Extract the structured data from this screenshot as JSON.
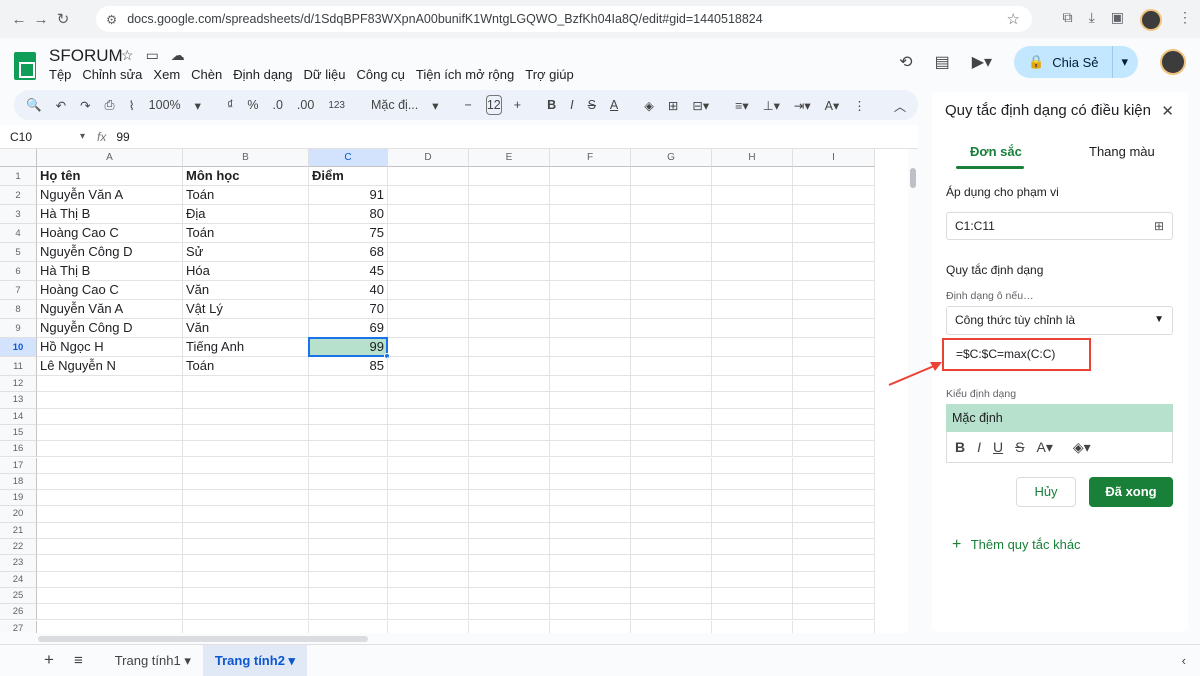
{
  "browser": {
    "url": "docs.google.com/spreadsheets/d/1SdqBPF83WXpnA00bunifK1WntgLGQWO_BzfKh04Ia8Q/edit#gid=1440518824"
  },
  "app": {
    "title": "SFORUM",
    "menu": [
      "Tệp",
      "Chỉnh sửa",
      "Xem",
      "Chèn",
      "Định dạng",
      "Dữ liệu",
      "Công cụ",
      "Tiện ích mở rộng",
      "Trợ giúp"
    ],
    "share_label": "Chia Sẻ"
  },
  "toolbar": {
    "zoom": "100%",
    "currency": "₫",
    "percent": "%",
    "dec_dec": ".0",
    "dec_inc": ".00",
    "number_format": "123",
    "font": "Mặc đị...",
    "font_size": "12"
  },
  "formula_bar": {
    "cell_ref": "C10",
    "fx": "fx",
    "value": "99"
  },
  "sheet": {
    "columns": [
      "A",
      "B",
      "C",
      "D",
      "E",
      "F",
      "G",
      "H",
      "I"
    ],
    "rows": [
      "1",
      "2",
      "3",
      "4",
      "5",
      "6",
      "7",
      "8",
      "9",
      "10",
      "11",
      "12",
      "13",
      "14",
      "15",
      "16",
      "17",
      "18",
      "19",
      "20",
      "21",
      "22",
      "23",
      "24",
      "25",
      "26",
      "27"
    ],
    "data": [
      [
        "Họ tên",
        "Môn học",
        "Điểm"
      ],
      [
        "Nguyễn Văn A",
        "Toán",
        "91"
      ],
      [
        "Hà Thị B",
        "Địa",
        "80"
      ],
      [
        "Hoàng Cao C",
        "Toán",
        "75"
      ],
      [
        "Nguyễn Công D",
        "Sử",
        "68"
      ],
      [
        "Hà Thị B",
        "Hóa",
        "45"
      ],
      [
        "Hoàng Cao C",
        "Văn",
        "40"
      ],
      [
        "Nguyễn Văn A",
        "Vật Lý",
        "70"
      ],
      [
        "Nguyễn Công D",
        "Văn",
        "69"
      ],
      [
        "Hồ Ngọc H",
        "Tiếng Anh",
        "99"
      ],
      [
        "Lê Nguyễn N",
        "Toán",
        "85"
      ]
    ]
  },
  "tabs": [
    {
      "label": "Trang tính1"
    },
    {
      "label": "Trang tính2"
    }
  ],
  "panel": {
    "title": "Quy tắc định dạng có điều kiện",
    "tab_single": "Đơn sắc",
    "tab_scale": "Thang màu",
    "range_label": "Áp dụng cho phạm vi",
    "range_value": "C1:C11",
    "rules_label": "Quy tắc định dạng",
    "condition_label": "Định dạng ô nếu…",
    "condition_value": "Công thức tùy chỉnh là",
    "formula": "=$C:$C=max(C:C)",
    "style_label": "Kiểu định dạng",
    "style_preview": "Mặc định",
    "cancel": "Hủy",
    "done": "Đã xong",
    "add_rule": "Thêm quy tắc khác"
  },
  "colors": {
    "accent": "#188038",
    "highlight": "#b7e1cd",
    "selection": "#1a73e8",
    "annotation": "#ea4335"
  }
}
